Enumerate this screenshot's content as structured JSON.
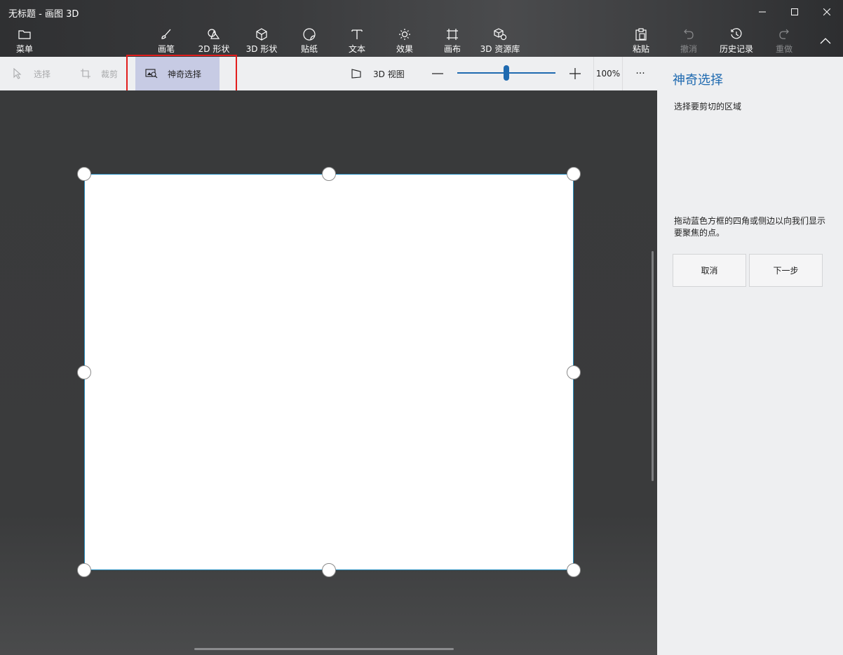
{
  "window": {
    "title": "无标题 - 画图 3D"
  },
  "toolbar": {
    "menu": "菜单",
    "tools": [
      {
        "label": "画笔",
        "icon": "brush-icon"
      },
      {
        "label": "2D 形状",
        "icon": "2d-shapes-icon"
      },
      {
        "label": "3D 形状",
        "icon": "3d-shapes-icon"
      },
      {
        "label": "贴纸",
        "icon": "stickers-icon"
      },
      {
        "label": "文本",
        "icon": "text-icon"
      },
      {
        "label": "效果",
        "icon": "effects-icon"
      },
      {
        "label": "画布",
        "icon": "canvas-icon"
      },
      {
        "label": "3D 资源库",
        "icon": "3d-library-icon"
      }
    ],
    "paste": "粘贴",
    "undo": "撤消",
    "history": "历史记录",
    "redo": "重做"
  },
  "subbar": {
    "select": "选择",
    "crop": "裁剪",
    "magic_select": "神奇选择",
    "view_3d": "3D 视图",
    "zoom_percent": "100%",
    "zoom_level": 0.5,
    "more": "···"
  },
  "panel": {
    "title": "神奇选择",
    "subtitle": "选择要剪切的区域",
    "hint": "拖动蓝色方框的四角或侧边以向我们显示要聚焦的点。",
    "cancel": "取消",
    "next": "下一步"
  },
  "colors": {
    "accent": "#1f6ab0",
    "highlight_selected": "#c7cbe4",
    "annotation_red": "#e21d1d"
  }
}
